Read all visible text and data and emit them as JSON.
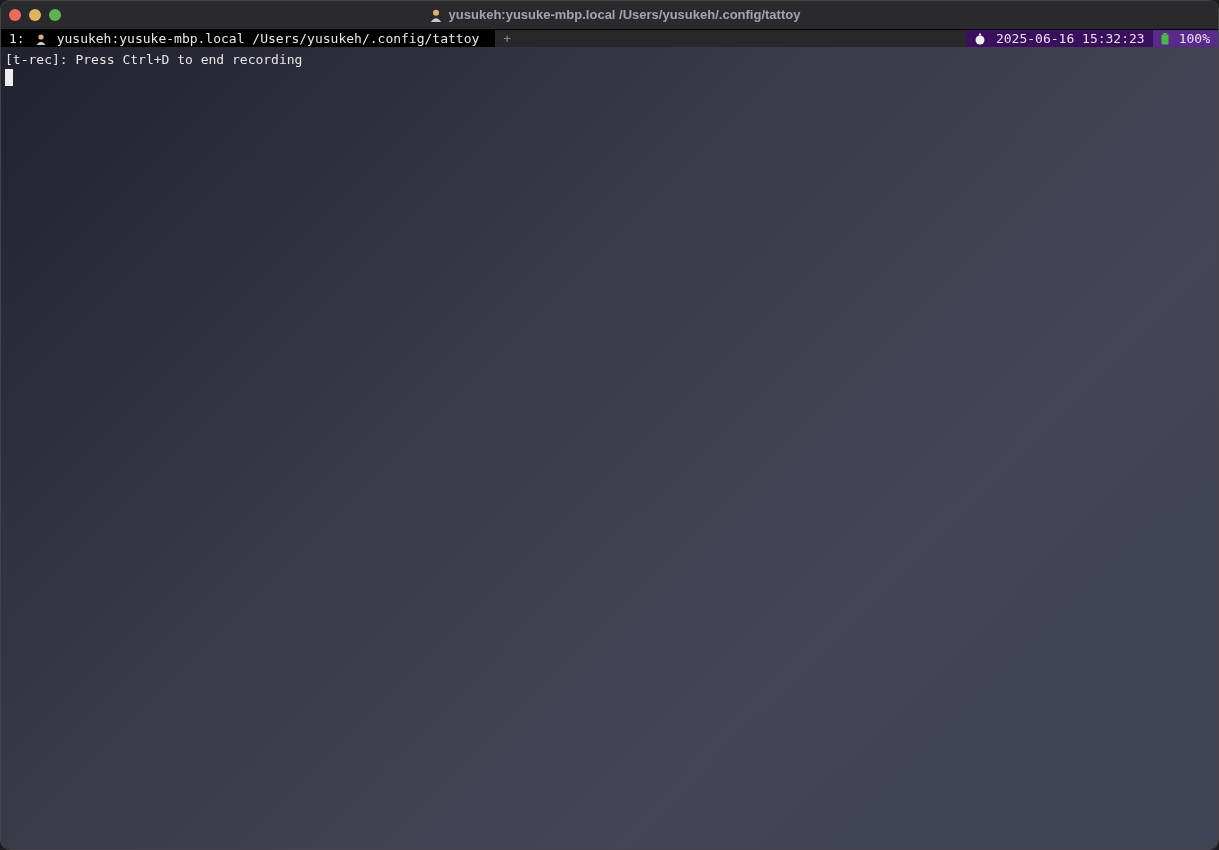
{
  "window": {
    "title": "yusukeh:yusuke-mbp.local /Users/yusukeh/.config/tattoy"
  },
  "tabs": [
    {
      "index": "1:",
      "label": "yusukeh:yusuke-mbp.local /Users/yusukeh/.config/tattoy",
      "selected": true
    }
  ],
  "new_tab": "+",
  "status": {
    "datetime": "2025-06-16 15:32:23",
    "battery": "100%"
  },
  "terminal": {
    "lines": [
      "[t-rec]: Press Ctrl+D to end recording"
    ]
  }
}
